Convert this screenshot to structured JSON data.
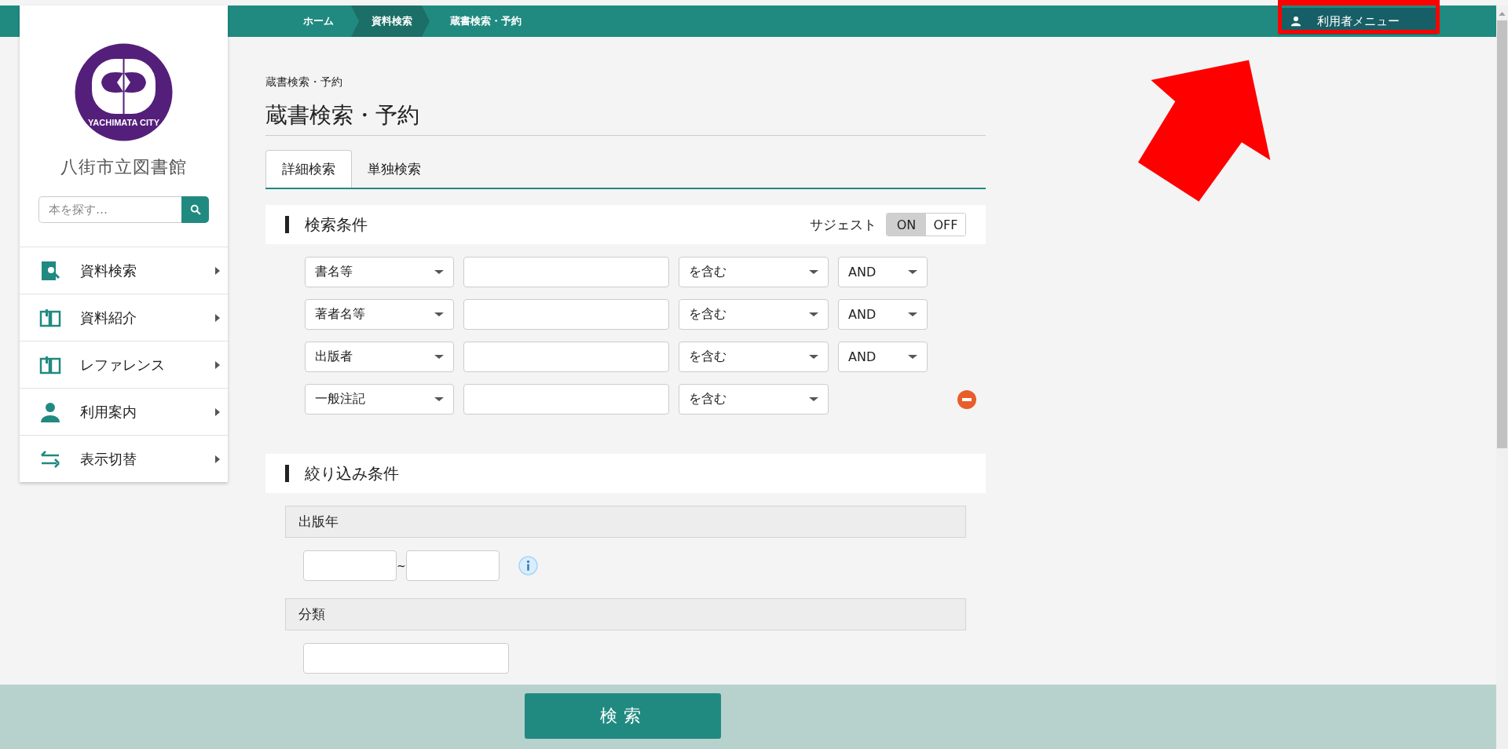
{
  "top_bar": {
    "breadcrumbs": [
      {
        "label": "ホーム",
        "selected": false
      },
      {
        "label": "資料検索",
        "selected": true
      },
      {
        "label": "蔵書検索・予約",
        "selected": false
      }
    ],
    "user_menu": "利用者メニュー"
  },
  "sidebar": {
    "logo_text": "YACHIMATA CITY",
    "library_name": "八街市立図書館",
    "search": {
      "placeholder": "本を探す…"
    },
    "items": [
      {
        "label": "資料検索"
      },
      {
        "label": "資料紹介"
      },
      {
        "label": "レファレンス"
      },
      {
        "label": "利用案内"
      },
      {
        "label": "表示切替"
      }
    ]
  },
  "page": {
    "breadcrumb": "蔵書検索・予約",
    "title": "蔵書検索・予約",
    "tabs": [
      {
        "label": "詳細検索",
        "selected": true
      },
      {
        "label": "単独検索",
        "selected": false
      }
    ]
  },
  "search_conditions": {
    "heading": "検索条件",
    "suggest": {
      "label": "サジェスト",
      "options": [
        {
          "label": "ON",
          "selected": true
        },
        {
          "label": "OFF",
          "selected": false
        }
      ]
    },
    "rows": [
      {
        "field": "書名等",
        "match": "を含む",
        "operator": "AND",
        "removable": false
      },
      {
        "field": "著者名等",
        "match": "を含む",
        "operator": "AND",
        "removable": false
      },
      {
        "field": "出版者",
        "match": "を含む",
        "operator": "AND",
        "removable": false
      },
      {
        "field": "一般注記",
        "match": "を含む",
        "removable": true
      }
    ]
  },
  "filters": {
    "heading": "絞り込み条件",
    "groups": [
      {
        "label": "出版年",
        "kind": "range",
        "separator": "~"
      },
      {
        "label": "分類",
        "kind": "text"
      }
    ]
  },
  "search_button": "検索"
}
